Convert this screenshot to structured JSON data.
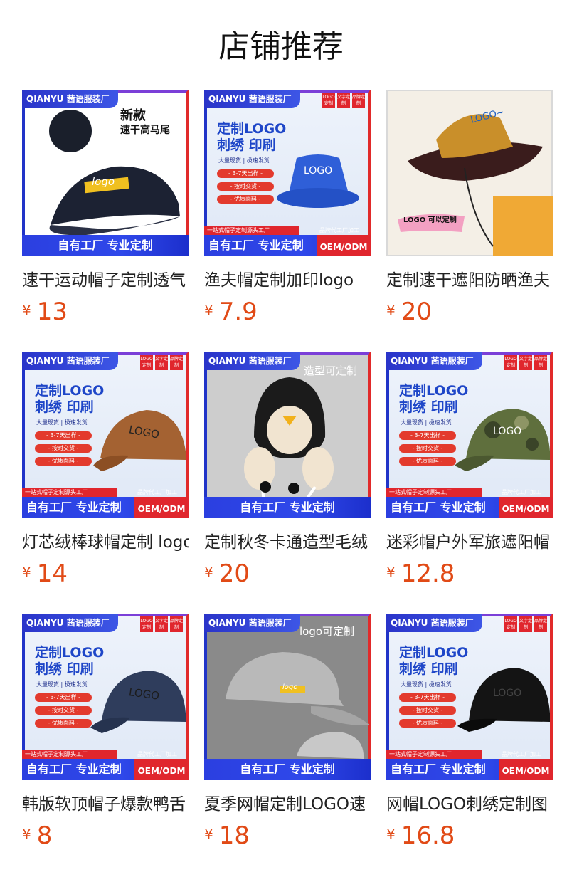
{
  "section_title": "店铺推荐",
  "products": [
    {
      "name": "速干运动帽子定制透气",
      "currency": "¥",
      "price": "13"
    },
    {
      "name": "渔夫帽定制加印logo",
      "currency": "¥",
      "price": "7.9"
    },
    {
      "name": "定制速干遮阳防晒渔夫",
      "currency": "¥",
      "price": "20"
    },
    {
      "name": "灯芯绒棒球帽定制 logo",
      "currency": "¥",
      "price": "14"
    },
    {
      "name": "定制秋冬卡通造型毛绒",
      "currency": "¥",
      "price": "20"
    },
    {
      "name": "迷彩帽户外军旅遮阳帽",
      "currency": "¥",
      "price": "12.8"
    },
    {
      "name": "韩版软顶帽子爆款鸭舌",
      "currency": "¥",
      "price": "8"
    },
    {
      "name": "夏季网帽定制LOGO速",
      "currency": "¥",
      "price": "18"
    },
    {
      "name": "网帽LOGO刺绣定制图",
      "currency": "¥",
      "price": "16.8"
    }
  ],
  "poster": {
    "brand": "QIANYU 茜语服装厂",
    "factory": "自有工厂  专业定制",
    "oem": "OEM/ODM",
    "oem_small": "品牌代工厂加工",
    "ribbon": "一站式帽子定制源头工厂",
    "headline_1": "定制LOGO",
    "headline_2": "刺绣 印刷",
    "sub": "大量现货 | 极速发货",
    "pill_1": "- 3-7天出样 -",
    "pill_2": "- 按时交货 -",
    "pill_3": "- 优质面料 -",
    "tag_1": "LOGO定制",
    "tag_2": "文字定制",
    "tag_3": "品牌定制",
    "new_1": "新款",
    "new_2": "速干高马尾",
    "logo_word": "logo",
    "logo_caps": "LOGO",
    "logo_tilde": "LOGO~",
    "logo_ok": "LOGO 可以定制",
    "shape_custom": "造型可定制",
    "logo_custom": "logo可定制"
  },
  "colors": {
    "price": "#e14a16",
    "poster_blue": "#2b3fe0",
    "poster_red": "#e0262d"
  }
}
